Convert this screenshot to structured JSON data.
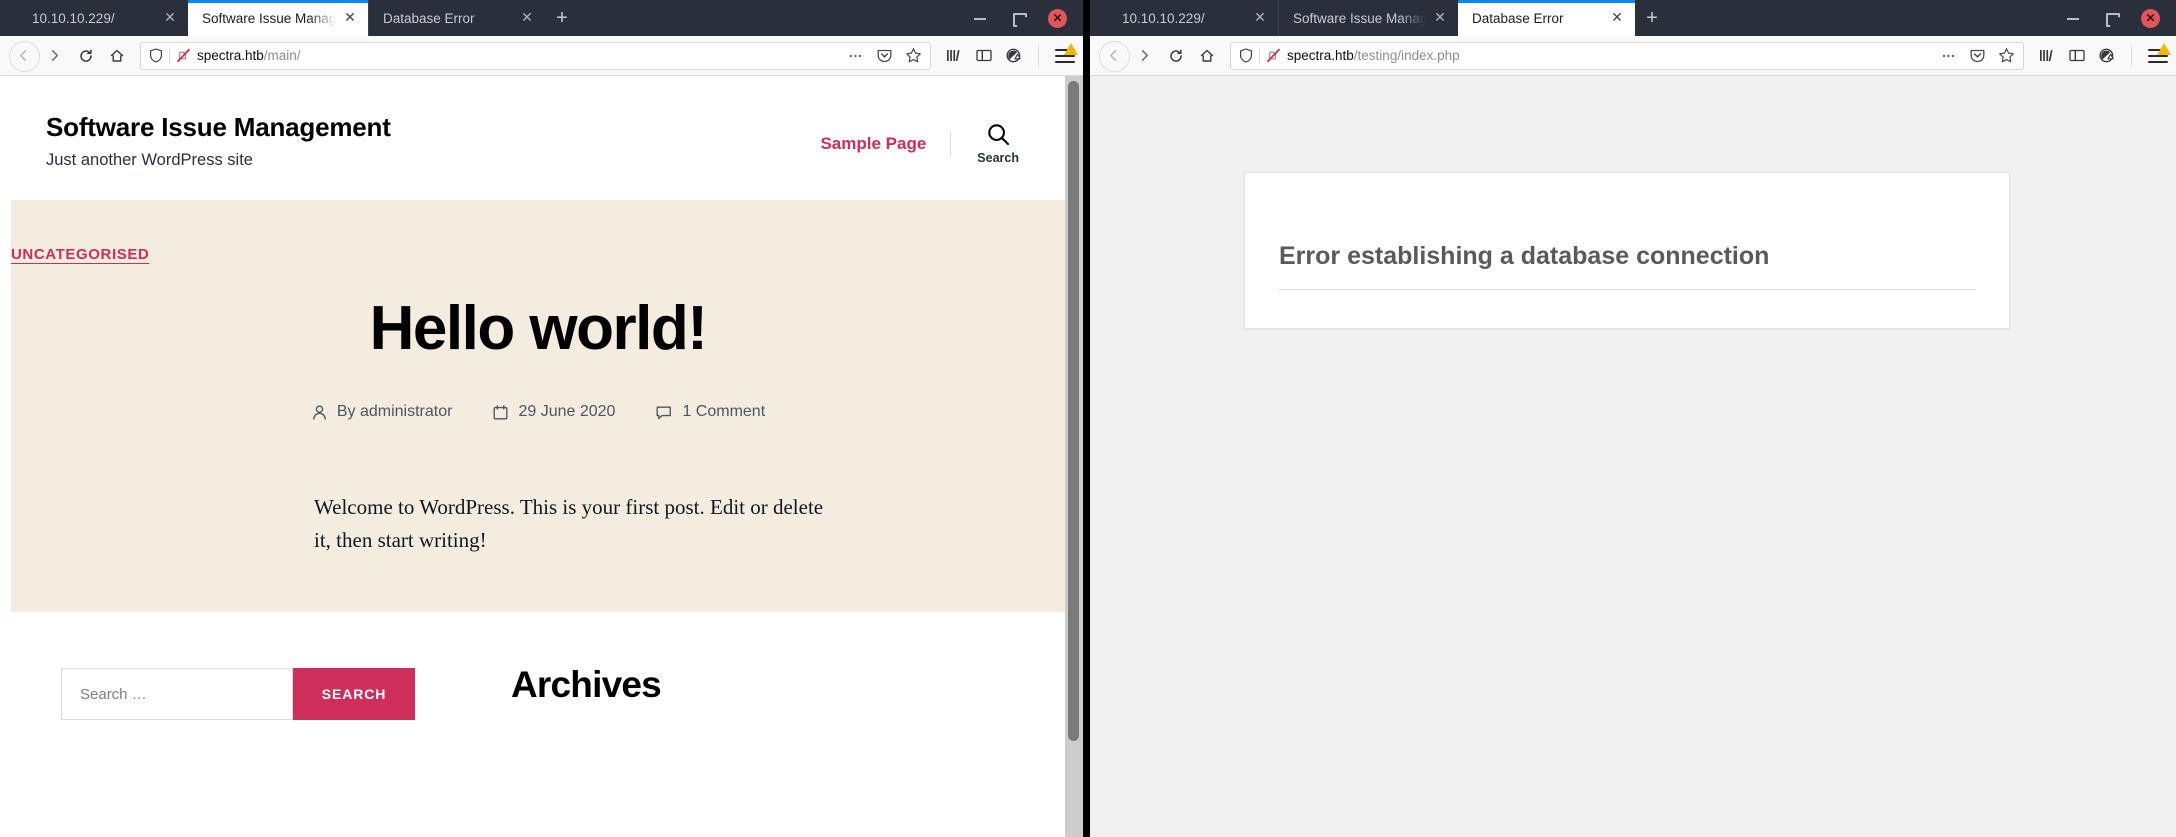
{
  "windows": [
    {
      "id": "left",
      "tabs": [
        {
          "label": "10.10.10.229/",
          "active": false
        },
        {
          "label": "Software Issue Management",
          "active": true
        },
        {
          "label": "Database Error",
          "active": false
        }
      ],
      "newtab_label": "+",
      "controls": {
        "minimize": "–",
        "maximize": "□",
        "close": "✕"
      },
      "url": {
        "host": "spectra.htb",
        "path": "/main/"
      },
      "page": {
        "type": "wordpress",
        "site_title": "Software Issue Management",
        "site_description": "Just another WordPress site",
        "nav": {
          "sample_page": "Sample Page",
          "search_label": "Search"
        },
        "post": {
          "category": "UNCATEGORISED",
          "title": "Hello world!",
          "author": "By administrator",
          "date": "29 June 2020",
          "comments": "1 Comment",
          "body": "Welcome to WordPress. This is your first post. Edit or delete it, then start writing!"
        },
        "widgets": {
          "search_placeholder": "Search …",
          "search_value": "",
          "search_button": "SEARCH",
          "archives_title": "Archives"
        }
      }
    },
    {
      "id": "right",
      "tabs": [
        {
          "label": "10.10.10.229/",
          "active": false
        },
        {
          "label": "Software Issue Management",
          "active": false
        },
        {
          "label": "Database Error",
          "active": true
        }
      ],
      "newtab_label": "+",
      "controls": {
        "minimize": "–",
        "maximize": "□",
        "close": "✕"
      },
      "url": {
        "host": "spectra.htb",
        "path": "/testing/index.php"
      },
      "page": {
        "type": "error",
        "error_title": "Error establishing a database connection"
      }
    }
  ],
  "colors": {
    "accent_pink": "#cf2e5b",
    "hero_beige": "#f4eddf",
    "chrome_dark": "#2b2e3b",
    "tab_active_bar": "#0a84ff",
    "close_red": "#e0575b",
    "error_gray": "#585a5c"
  },
  "icons": {
    "back": "←",
    "forward": "→",
    "reload": "↻",
    "home": "⌂",
    "page_actions": "⋯"
  }
}
